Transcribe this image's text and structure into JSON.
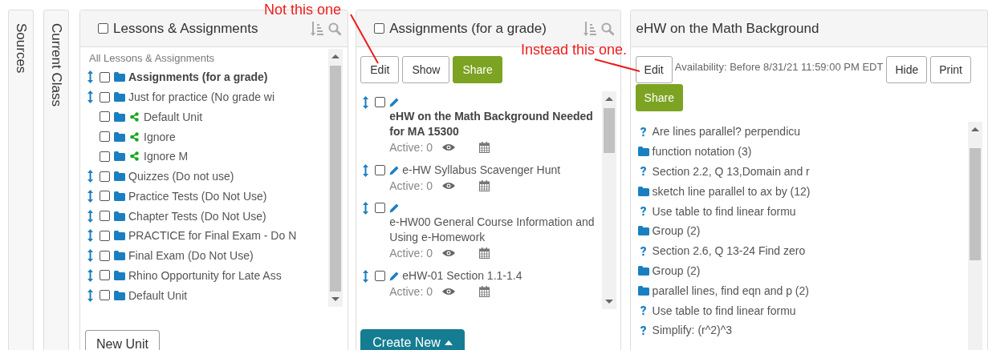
{
  "side_tabs": [
    {
      "label": "Sources"
    },
    {
      "label": "Current Class"
    }
  ],
  "lessons_panel": {
    "title": "Lessons & Assignments",
    "select_all_checked": false,
    "root_label": "All Lessons & Assignments",
    "items": [
      {
        "label": "Assignments (for a grade)",
        "kind": "unit",
        "selected": true,
        "checked": false
      },
      {
        "label": "Just for practice (No grade wi",
        "kind": "unit",
        "selected": false,
        "checked": false
      },
      {
        "label": "Default Unit",
        "kind": "shared_unit",
        "selected": false,
        "checked": false
      },
      {
        "label": "Ignore",
        "kind": "shared_unit",
        "selected": false,
        "checked": false
      },
      {
        "label": "Ignore M",
        "kind": "shared_unit",
        "selected": false,
        "checked": false
      },
      {
        "label": "Quizzes (Do not use)",
        "kind": "unit",
        "selected": false,
        "checked": false
      },
      {
        "label": "Practice Tests (Do Not Use)",
        "kind": "unit",
        "selected": false,
        "checked": false
      },
      {
        "label": "Chapter Tests (Do Not Use)",
        "kind": "unit",
        "selected": false,
        "checked": false
      },
      {
        "label": "PRACTICE for Final Exam - Do N",
        "kind": "unit",
        "selected": false,
        "checked": false
      },
      {
        "label": "Final Exam (Do Not Use)",
        "kind": "unit",
        "selected": false,
        "checked": false
      },
      {
        "label": "Rhino Opportunity for Late Ass",
        "kind": "unit",
        "selected": false,
        "checked": false
      },
      {
        "label": "Default Unit",
        "kind": "unit",
        "selected": false,
        "checked": false
      }
    ],
    "new_unit_button": "New Unit"
  },
  "assignments_panel": {
    "title": "Assignments (for a grade)",
    "select_all_checked": false,
    "buttons": [
      {
        "label": "Edit",
        "kind": "plain"
      },
      {
        "label": "Show",
        "kind": "plain"
      },
      {
        "label": "Share",
        "kind": "primary"
      }
    ],
    "items": [
      {
        "title": "eHW on the Math Background Needed for MA 15300",
        "kind": "stacked",
        "selected": true,
        "checked": false,
        "status": "Active: 0"
      },
      {
        "title": "e-HW Syllabus Scavenger Hunt",
        "kind": "inline",
        "selected": false,
        "checked": false,
        "status": "Active: 0"
      },
      {
        "title": "e-HW00 General Course Information and Using e-Homework",
        "kind": "stacked",
        "selected": false,
        "checked": false,
        "status": "Active: 0"
      },
      {
        "title": "eHW-01 Section 1.1-1.4",
        "kind": "inline",
        "selected": false,
        "checked": false,
        "status": "Active: 0"
      }
    ],
    "create_button": "Create New"
  },
  "detail_panel": {
    "title": "eHW on the Math Background",
    "toolbar": [
      {
        "kind": "button",
        "text": "Edit"
      },
      {
        "kind": "text",
        "text": "Availability: Before 8/31/21 11:59:00 PM EDT"
      },
      {
        "kind": "button",
        "text": "Hide"
      },
      {
        "kind": "button",
        "text": "Print"
      },
      {
        "kind": "primary",
        "text": "Share"
      }
    ],
    "items": [
      {
        "kind": "question",
        "label": "Are lines parallel? perpendicu"
      },
      {
        "kind": "folder",
        "label": "function notation (3)"
      },
      {
        "kind": "question",
        "label": "Section 2.2, Q 13,Domain and r"
      },
      {
        "kind": "folder",
        "label": "sketch line parallel to ax by (12)"
      },
      {
        "kind": "question",
        "label": "Use table to find linear formu"
      },
      {
        "kind": "folder",
        "label": "Group (2)"
      },
      {
        "kind": "question",
        "label": "Section 2.6, Q 13-24 Find zero"
      },
      {
        "kind": "folder",
        "label": "Group (2)"
      },
      {
        "kind": "folder",
        "label": "parallel lines, find eqn and p (2)"
      },
      {
        "kind": "question",
        "label": "Use table to find linear formu"
      },
      {
        "kind": "question",
        "label": "Simplify: (r^2)^3"
      }
    ]
  },
  "annotations": [
    {
      "text": "Not this one"
    },
    {
      "text": "Instead this one."
    }
  ]
}
